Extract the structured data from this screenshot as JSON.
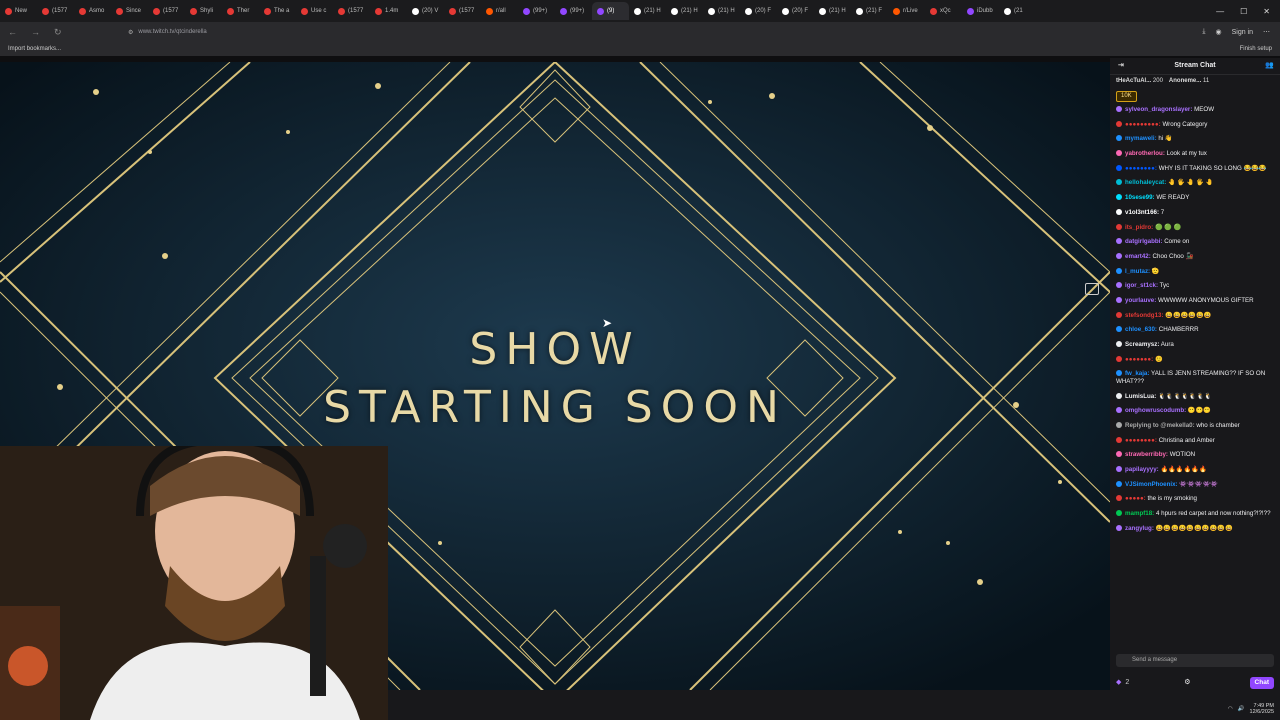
{
  "tabs": [
    {
      "label": "New",
      "color": "#e53935"
    },
    {
      "label": "(1577",
      "color": "#e53935"
    },
    {
      "label": "Asmo",
      "color": "#e53935"
    },
    {
      "label": "Since",
      "color": "#e53935"
    },
    {
      "label": "(1577",
      "color": "#e53935"
    },
    {
      "label": "Shyli",
      "color": "#e53935"
    },
    {
      "label": "Ther",
      "color": "#e53935"
    },
    {
      "label": "The a",
      "color": "#e53935"
    },
    {
      "label": "Use c",
      "color": "#e53935"
    },
    {
      "label": "(1577",
      "color": "#e53935"
    },
    {
      "label": "1.4m",
      "color": "#e53935"
    },
    {
      "label": "(20) V",
      "color": "#ffffff"
    },
    {
      "label": "(1577",
      "color": "#e53935"
    },
    {
      "label": "r/all",
      "color": "#ff5700"
    },
    {
      "label": "(99+)",
      "color": "#9147ff"
    },
    {
      "label": "(99+)",
      "color": "#9147ff"
    },
    {
      "label": "(9)",
      "color": "#9147ff",
      "active": true
    },
    {
      "label": "(21) H",
      "color": "#ffffff"
    },
    {
      "label": "(21) H",
      "color": "#ffffff"
    },
    {
      "label": "(21) H",
      "color": "#ffffff"
    },
    {
      "label": "(20) F",
      "color": "#ffffff"
    },
    {
      "label": "(20) F",
      "color": "#ffffff"
    },
    {
      "label": "(21) H",
      "color": "#ffffff"
    },
    {
      "label": "(21) F",
      "color": "#ffffff"
    },
    {
      "label": "r/Live",
      "color": "#ff5700"
    },
    {
      "label": "xQc",
      "color": "#e53935"
    },
    {
      "label": "iDubb",
      "color": "#9147ff"
    },
    {
      "label": "(21",
      "color": "#ffffff"
    }
  ],
  "address": {
    "url": "www.twitch.tv/qtcinderella"
  },
  "browser": {
    "sign_in": "Sign in",
    "import_bookmarks": "Import bookmarks...",
    "finish_setup": "Finish setup"
  },
  "stream": {
    "line1": "SHOW",
    "line2": "STARTING SOON"
  },
  "chat": {
    "title": "Stream Chat",
    "pinned": [
      {
        "user": "tHeAcTuAl...",
        "amount": "200"
      },
      {
        "user": "Anoneme...",
        "amount": "11"
      }
    ],
    "badge": "10K",
    "messages": [
      {
        "user": "sylveon_dragonslayer:",
        "text": "MEOW",
        "color": "#a970ff"
      },
      {
        "user": "●●●●●●●●●:",
        "text": "Wrong Category",
        "color": "#e53935"
      },
      {
        "user": "mymaweli:",
        "text": "hi 👋",
        "color": "#1e90ff"
      },
      {
        "user": "yabrotherlou:",
        "text": "Look at my tux",
        "color": "#ff69b4"
      },
      {
        "user": "●●●●●●●●:",
        "text": "WHY IS IT TAKING SO LONG 😂😂😂",
        "color": "#0057ff"
      },
      {
        "user": "hellohaleycat:",
        "text": "🤚 🖐 🤚 🖐 🤚",
        "color": "#00bcd4"
      },
      {
        "user": "10sese99:",
        "text": "WE READY",
        "color": "#00e0ff"
      },
      {
        "user": "v1ol3nt166:",
        "text": "7",
        "color": "#ffffff"
      },
      {
        "user": "its_pidro:",
        "text": "🟢 🟢 🟢",
        "color": "#e53935"
      },
      {
        "user": "datgirlgabbi:",
        "text": "Come on",
        "color": "#a970ff"
      },
      {
        "user": "emart42:",
        "text": "Choo Choo 🚂",
        "color": "#a970ff"
      },
      {
        "user": "l_mutaz:",
        "text": "🫡",
        "color": "#1e90ff"
      },
      {
        "user": "igor_st1ck:",
        "text": "Tyc",
        "color": "#a970ff"
      },
      {
        "user": "yourlauve:",
        "text": "WWWWW ANONYMOUS GIFTER",
        "color": "#a970ff"
      },
      {
        "user": "stefsondg13:",
        "text": "😀😀😀😀😀😀",
        "color": "#e53935"
      },
      {
        "user": "chloe_630:",
        "text": "CHAMBERRR",
        "color": "#1e90ff"
      },
      {
        "user": "Screamysz:",
        "text": "Aura",
        "color": "#efeff1"
      },
      {
        "user": "●●●●●●●:",
        "text": "🙂",
        "color": "#e53935"
      },
      {
        "user": "fw_kaja:",
        "text": "YALL IS JENN STREAMING?? IF SO ON WHAT???",
        "color": "#1e90ff"
      },
      {
        "user": "LumisLua:",
        "text": "🐧🐧🐧🐧🐧🐧🐧",
        "color": "#efeff1"
      },
      {
        "user": "omghowruscodumb:",
        "text": "😶😶😶",
        "color": "#a970ff"
      },
      {
        "user": "Replying to @mekella0:",
        "text": "who is chamber",
        "color": "#aaaaaa"
      },
      {
        "user": "●●●●●●●●:",
        "text": "Christina and Amber",
        "color": "#e53935"
      },
      {
        "user": "strawberribby:",
        "text": "WOTION",
        "color": "#ff69b4"
      },
      {
        "user": "papilayyyy:",
        "text": "🔥🔥🔥🔥🔥🔥",
        "color": "#a970ff"
      },
      {
        "user": "VJSimonPhoenix:",
        "text": "👾👾👾👾👾",
        "color": "#1e90ff"
      },
      {
        "user": "●●●●●:",
        "text": "the is my smoking",
        "color": "#e53935"
      },
      {
        "user": "mampf18:",
        "text": "4 hpurs red carpet and now nothing?!?!??",
        "color": "#00c853"
      },
      {
        "user": "zangylug:",
        "text": "😀😀😀😀😀😀😀😀😀😀",
        "color": "#a970ff"
      }
    ],
    "input_placeholder": "Send a message",
    "points": "2",
    "chat_button": "Chat"
  },
  "taskbar": {
    "time": "7:49 PM",
    "date": "12/6/2025"
  }
}
